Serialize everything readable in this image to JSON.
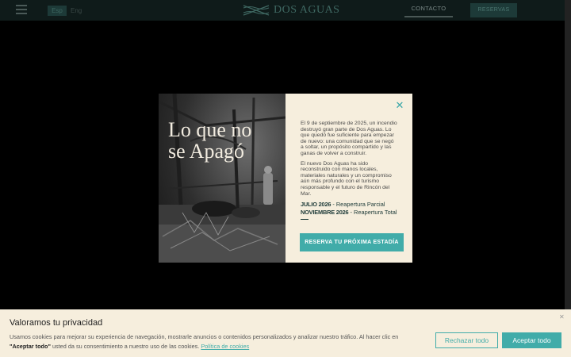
{
  "header": {
    "lang_es": "Esp",
    "lang_en": "Eng",
    "logo_text": "DOS AGUAS",
    "contacto": "CONTACTO",
    "reservas": "RESERVAS"
  },
  "modal": {
    "title_line1": "Lo que no",
    "title_line2": "se Apagó",
    "paragraph1": "El 9 de septiembre de 2025, un incendio destruyó gran parte de Dos Aguas. Lo que quedó fue suficiente para empezar de nuevo: una comunidad que se negó a soltar, un propósito compartido y las ganas de volver a construir.",
    "paragraph2": "El nuevo Dos Aguas ha sido reconstruido con manos locales, materiales naturales y un compromiso aún más profundo con el turismo responsable y el futuro de Rincón del Mar.",
    "schedule": [
      {
        "date": "JULIO 2026",
        "label": " - Reapertura Parcial"
      },
      {
        "date": "NOVIEMBRE 2026",
        "label": " - Reapertura Total"
      }
    ],
    "cta": "RESERVA TU PRÓXIMA ESTADÍA",
    "close_symbol": "✕"
  },
  "cookie": {
    "title": "Valoramos tu privacidad",
    "text": "Usamos cookies para mejorar su experiencia de navegación, mostrarle anuncios o contenidos personalizados y analizar nuestro tráfico. Al hacer clic en",
    "text_bold": "\"Aceptar todo\"",
    "text_after": " usted da su consentimiento a nuestro uso de las cookies. ",
    "link": "Política de cookies",
    "reject": "Rechazar todo",
    "accept": "Aceptar todo",
    "close_symbol": "✕"
  },
  "colors": {
    "accent": "#41aca9",
    "header_bg": "#0f1b1a",
    "cream": "#f6eedd",
    "dark_teal": "#1d3a38"
  },
  "icons": {
    "menu": "hamburger-icon",
    "logo": "logo-mark-icon",
    "close": "close-icon"
  }
}
